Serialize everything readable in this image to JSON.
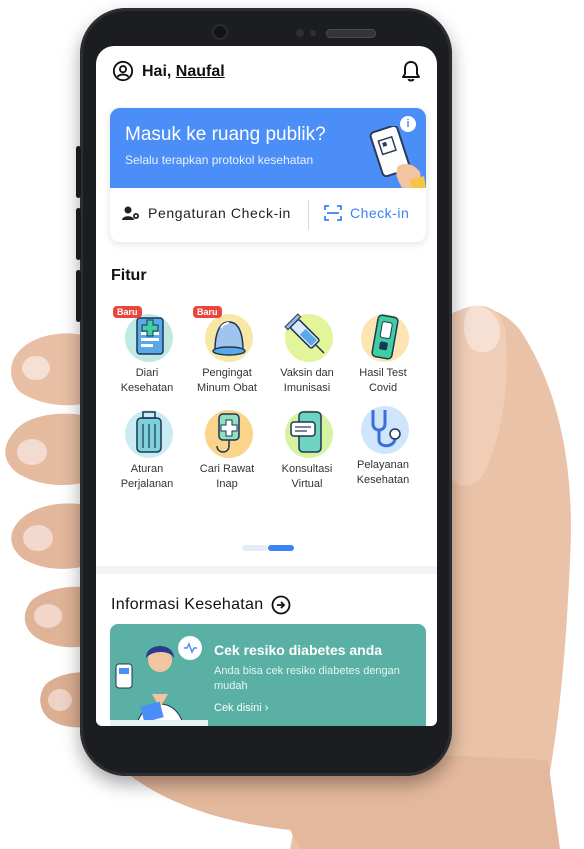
{
  "header": {
    "greeting": "Hai, ",
    "user_name": "Naufal"
  },
  "checkin_card": {
    "title": "Masuk ke ruang publik?",
    "subtitle": "Selalu terapkan protokol kesehatan",
    "info_glyph": "i",
    "settings_label": "Pengaturan Check-in",
    "checkin_label": "Check-in",
    "accent_color": "#4c8ef7"
  },
  "features": {
    "title": "Fitur",
    "items": [
      {
        "label_1": "Diari",
        "label_2": "Kesehatan",
        "badge": "Baru",
        "icon": "clipboard-icon"
      },
      {
        "label_1": "Pengingat",
        "label_2": "Minum Obat",
        "badge": "Baru",
        "icon": "bell-reminder-icon"
      },
      {
        "label_1": "Vaksin dan",
        "label_2": "Imunisasi",
        "badge": "",
        "icon": "syringe-icon"
      },
      {
        "label_1": "Hasil Test",
        "label_2": "Covid",
        "badge": "",
        "icon": "test-kit-icon"
      },
      {
        "label_1": "Aturan",
        "label_2": "Perjalanan",
        "badge": "",
        "icon": "luggage-icon"
      },
      {
        "label_1": "Cari Rawat",
        "label_2": "Inap",
        "badge": "",
        "icon": "iv-bag-icon"
      },
      {
        "label_1": "Konsultasi",
        "label_2": "Virtual",
        "badge": "",
        "icon": "chat-phone-icon"
      },
      {
        "label_1": "Pelayanan",
        "label_2": "Kesehatan",
        "badge": "",
        "icon": "stethoscope-icon"
      }
    ]
  },
  "info": {
    "title": "Informasi Kesehatan",
    "card_title": "Cek resiko diabetes anda",
    "card_subtitle": "Anda bisa cek resiko diabetes dengan mudah",
    "card_link": "Cek disini  ›",
    "card_color": "#5ab0a4"
  }
}
